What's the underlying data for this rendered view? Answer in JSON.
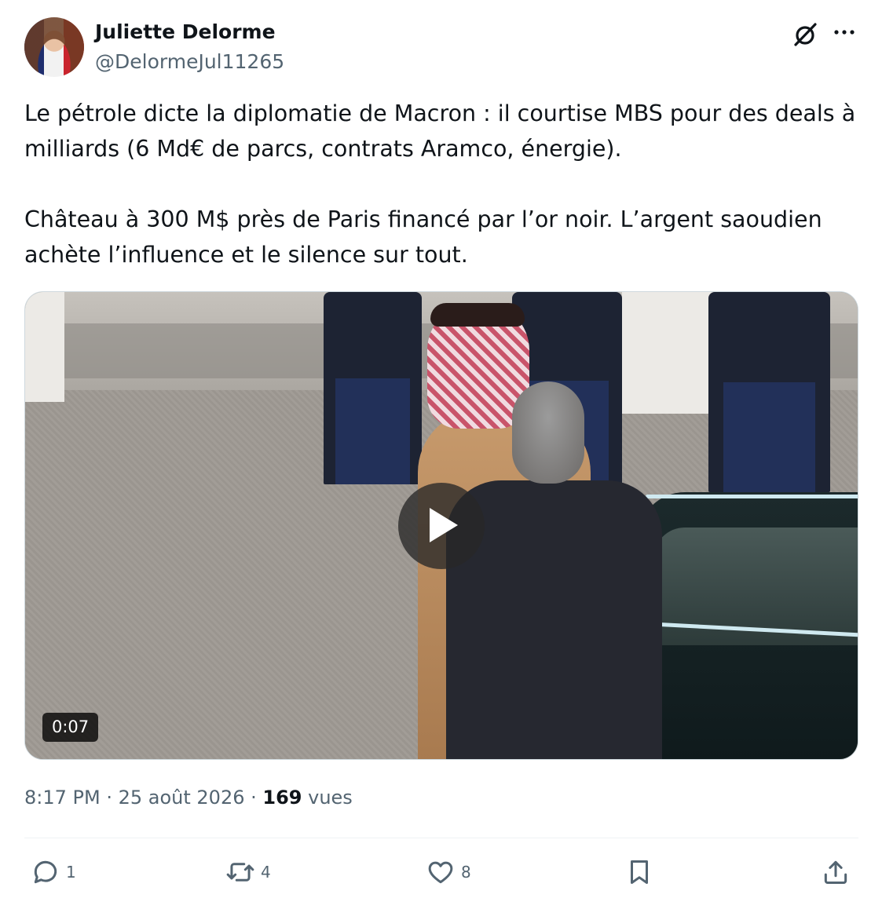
{
  "author": {
    "name": "Juliette Delorme",
    "handle": "@DelormeJul11265"
  },
  "tweet": {
    "paragraphs": [
      "Le pétrole dicte la diplomatie de Macron : il courtise MBS pour des deals à milliards (6 Md€ de parcs, contrats Aramco, énergie).",
      "Château à 300 M$ près de Paris financé par l’or noir. L’argent saoudien achète l’influence et le silence sur tout."
    ]
  },
  "media": {
    "duration": "0:07"
  },
  "meta": {
    "time": "8:17 PM",
    "separator": " · ",
    "date": "25 août 2026",
    "views_count": "169",
    "views_label": "vues"
  },
  "actions": {
    "reply_count": "1",
    "retweet_count": "4",
    "like_count": "8"
  },
  "icons": {
    "grok": "grok-icon",
    "more": "more-icon",
    "play": "play-icon",
    "reply": "reply-icon",
    "retweet": "retweet-icon",
    "like": "heart-icon",
    "bookmark": "bookmark-icon",
    "share": "share-icon"
  },
  "colors": {
    "text_primary": "#0f1419",
    "text_secondary": "#536471",
    "divider": "#eff3f4"
  }
}
